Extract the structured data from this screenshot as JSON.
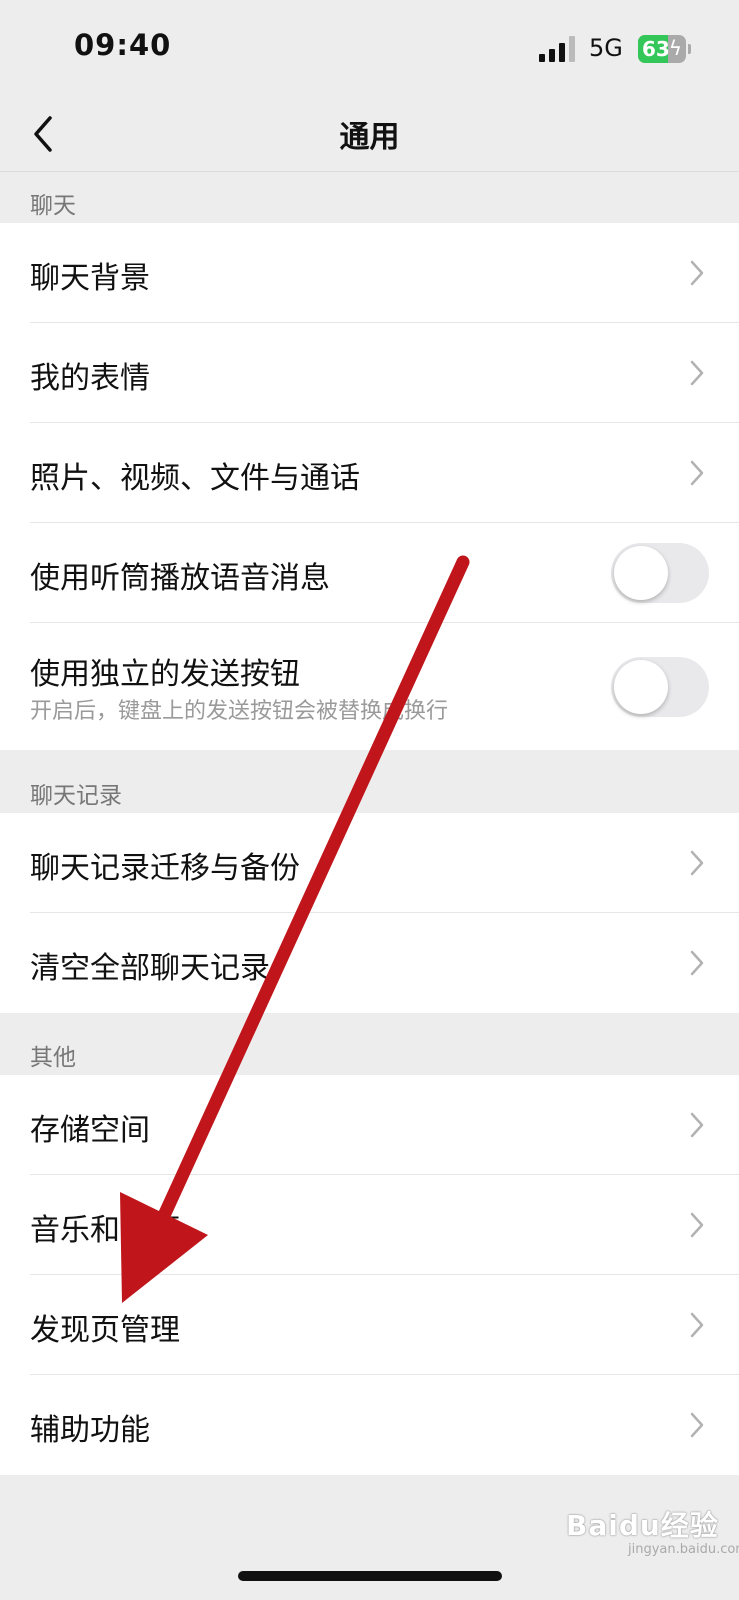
{
  "status_bar": {
    "time": "09:40",
    "network": "5G",
    "battery": "63",
    "battery_level": 0.63
  },
  "nav": {
    "title": "通用"
  },
  "sections": [
    {
      "header": "聊天",
      "items": [
        {
          "label": "聊天背景"
        },
        {
          "label": "我的表情"
        },
        {
          "label": "照片、视频、文件与通话"
        },
        {
          "label": "使用听筒播放语音消息",
          "toggle": false
        },
        {
          "label": "使用独立的发送按钮",
          "sublabel": "开启后，键盘上的发送按钮会被替换成换行",
          "toggle": false
        }
      ]
    },
    {
      "header": "聊天记录",
      "items": [
        {
          "label": "聊天记录迁移与备份"
        },
        {
          "label": "清空全部聊天记录"
        }
      ]
    },
    {
      "header": "其他",
      "items": [
        {
          "label": "存储空间"
        },
        {
          "label": "音乐和音频"
        },
        {
          "label": "发现页管理"
        },
        {
          "label": "辅助功能"
        }
      ]
    }
  ],
  "annotation": {
    "color": "#c0161b"
  },
  "watermark": {
    "text": "Baidu经验",
    "sub": "jingyan.baidu.com"
  }
}
